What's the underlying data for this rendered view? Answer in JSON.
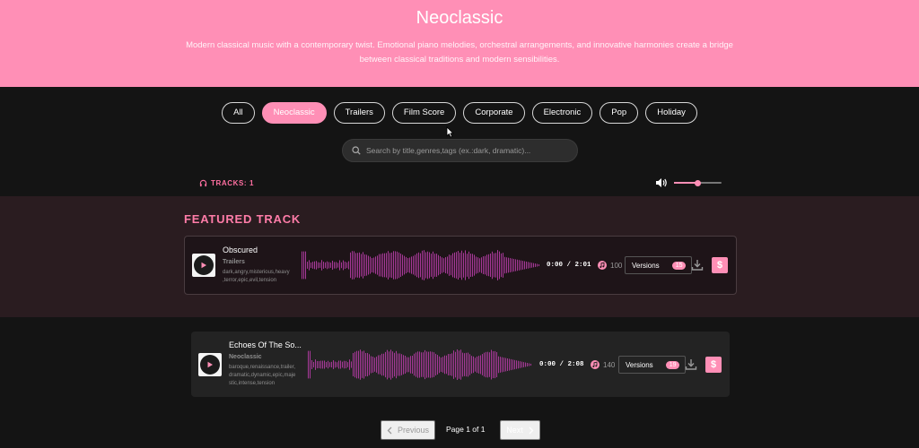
{
  "hero": {
    "title": "Neoclassic",
    "description": "Modern classical music with a contemporary twist. Emotional piano melodies, orchestral arrangements, and innovative harmonies create a bridge between classical traditions and modern sensibilities."
  },
  "filters": [
    {
      "label": "All",
      "active": false
    },
    {
      "label": "Neoclassic",
      "active": true
    },
    {
      "label": "Trailers",
      "active": false
    },
    {
      "label": "Film Score",
      "active": false
    },
    {
      "label": "Corporate",
      "active": false
    },
    {
      "label": "Electronic",
      "active": false
    },
    {
      "label": "Pop",
      "active": false
    },
    {
      "label": "Holiday",
      "active": false
    }
  ],
  "search": {
    "placeholder": "Search by title,genres,tags (ex.:dark, dramatic)..."
  },
  "tracks_label": "TRACKS: 1",
  "volume_level": 0.5,
  "featured_title": "FEATURED TRACK",
  "tracks": [
    {
      "title": "Obscured",
      "genre": "Trailers",
      "tags": [
        "dark,angry,misterious,heavy",
        ",terror,epic,evil,tension"
      ],
      "time": "0:00 / 2:01",
      "plays": "100",
      "versions_label": "Versions",
      "versions_count": "15",
      "buy_label": "$"
    },
    {
      "title": "Echoes Of The So...",
      "genre": "Neoclassic",
      "tags": [
        "baroque,renaissance,trailer,",
        "dramatic,dynamic,epic,maje",
        "stic,intense,tension"
      ],
      "time": "0:00 / 2:08",
      "plays": "140",
      "versions_label": "Versions",
      "versions_count": "19",
      "buy_label": "$"
    }
  ],
  "pagination": {
    "prev": "Previous",
    "info": "Page 1 of 1",
    "next": "Next"
  },
  "colors": {
    "accent": "#ff8fb6",
    "wave": "#a9399a",
    "background": "#141414"
  }
}
